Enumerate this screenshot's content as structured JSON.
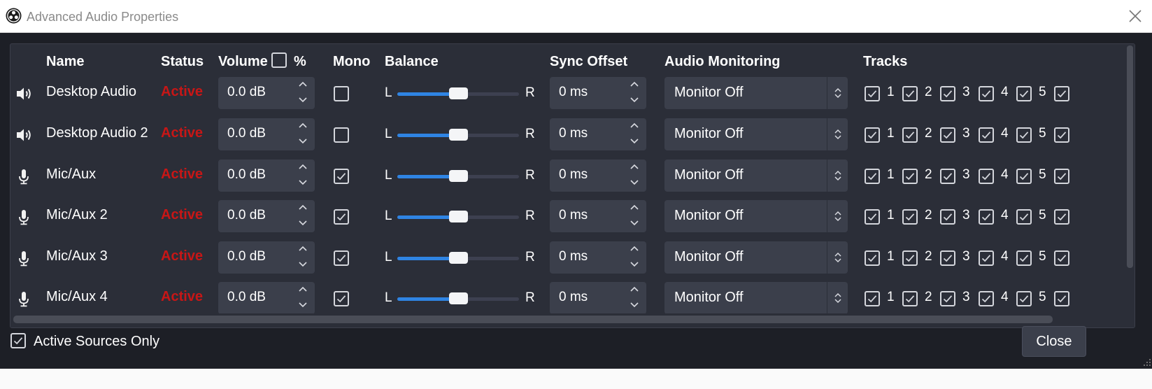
{
  "window": {
    "title": "Advanced Audio Properties",
    "logo_icon": "obs-logo-icon",
    "close_icon": "close-icon"
  },
  "columns": {
    "name": "Name",
    "status": "Status",
    "volume": "Volume",
    "volume_unit": "%",
    "mono": "Mono",
    "balance": "Balance",
    "sync_offset": "Sync Offset",
    "audio_monitoring": "Audio Monitoring",
    "tracks": "Tracks"
  },
  "volume_percent_checked": false,
  "balance_labels": {
    "left": "L",
    "right": "R"
  },
  "track_numbers": [
    "1",
    "2",
    "3",
    "4",
    "5"
  ],
  "sources": [
    {
      "icon": "speaker-icon",
      "name": "Desktop Audio",
      "status": "Active",
      "volume": "0.0 dB",
      "mono": false,
      "balance": 0.5,
      "sync_offset": "0 ms",
      "monitoring": "Monitor Off",
      "tracks": [
        true,
        true,
        true,
        true,
        true,
        true
      ]
    },
    {
      "icon": "speaker-icon",
      "name": "Desktop Audio 2",
      "status": "Active",
      "volume": "0.0 dB",
      "mono": false,
      "balance": 0.5,
      "sync_offset": "0 ms",
      "monitoring": "Monitor Off",
      "tracks": [
        true,
        true,
        true,
        true,
        true,
        true
      ]
    },
    {
      "icon": "microphone-icon",
      "name": "Mic/Aux",
      "status": "Active",
      "volume": "0.0 dB",
      "mono": true,
      "balance": 0.5,
      "sync_offset": "0 ms",
      "monitoring": "Monitor Off",
      "tracks": [
        true,
        true,
        true,
        true,
        true,
        true
      ]
    },
    {
      "icon": "microphone-icon",
      "name": "Mic/Aux 2",
      "status": "Active",
      "volume": "0.0 dB",
      "mono": true,
      "balance": 0.5,
      "sync_offset": "0 ms",
      "monitoring": "Monitor Off",
      "tracks": [
        true,
        true,
        true,
        true,
        true,
        true
      ]
    },
    {
      "icon": "microphone-icon",
      "name": "Mic/Aux 3",
      "status": "Active",
      "volume": "0.0 dB",
      "mono": true,
      "balance": 0.5,
      "sync_offset": "0 ms",
      "monitoring": "Monitor Off",
      "tracks": [
        true,
        true,
        true,
        true,
        true,
        true
      ]
    },
    {
      "icon": "microphone-icon",
      "name": "Mic/Aux 4",
      "status": "Active",
      "volume": "0.0 dB",
      "mono": true,
      "balance": 0.5,
      "sync_offset": "0 ms",
      "monitoring": "Monitor Off",
      "tracks": [
        true,
        true,
        true,
        true,
        true,
        true
      ]
    }
  ],
  "footer": {
    "active_sources_only_label": "Active Sources Only",
    "active_sources_only_checked": true,
    "close_label": "Close"
  },
  "colors": {
    "background": "#1d1f26",
    "panel": "#2b2e38",
    "field": "#3b3f4b",
    "active_status": "#c81616",
    "slider_fill": "#2f84e3"
  }
}
